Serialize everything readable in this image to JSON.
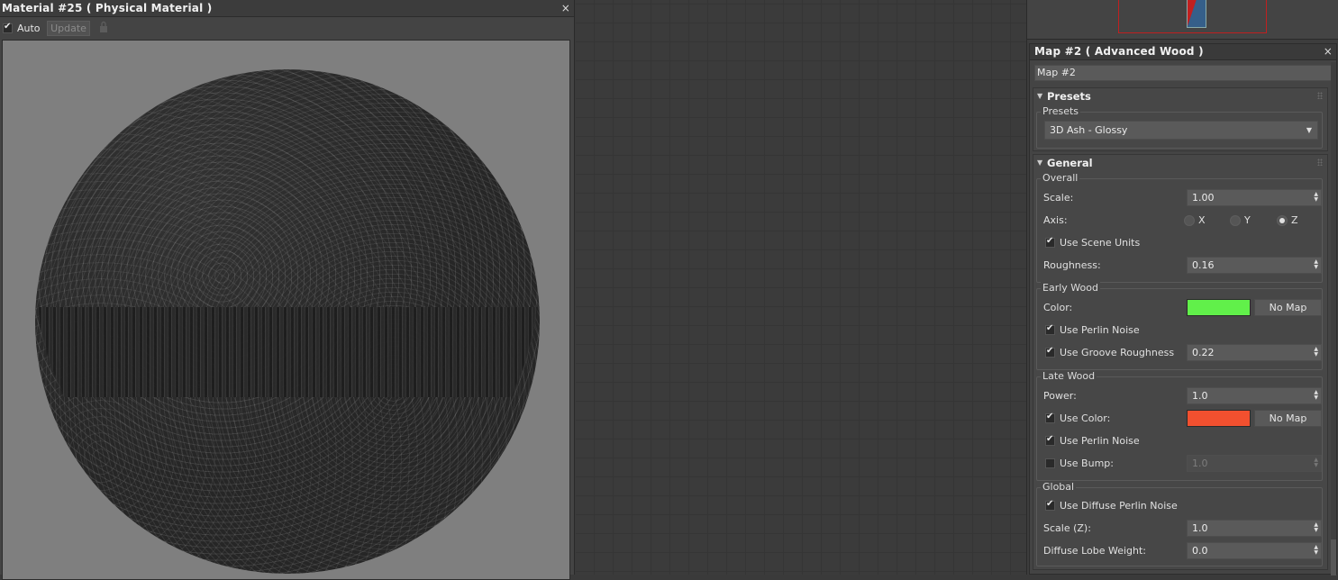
{
  "preview_window": {
    "title": "Material #25  ( Physical Material )",
    "close": "×",
    "auto_label": "Auto",
    "auto_checked": true,
    "update_label": "Update",
    "lock_icon": "lock-icon"
  },
  "nav_view": {
    "frame_color": "#c02020",
    "node_color": "#355f8a"
  },
  "params": {
    "title": "Map #2  ( Advanced Wood )",
    "close": "×",
    "map_name": "Map #2",
    "presets": {
      "heading": "Presets",
      "group_label": "Presets",
      "selected": "3D Ash - Glossy"
    },
    "general": {
      "heading": "General",
      "overall": {
        "label": "Overall",
        "scale_label": "Scale:",
        "scale_value": "1.00",
        "axis_label": "Axis:",
        "axis_options": [
          "X",
          "Y",
          "Z"
        ],
        "axis_selected": "Z",
        "use_scene_units_label": "Use Scene Units",
        "use_scene_units": true,
        "roughness_label": "Roughness:",
        "roughness_value": "0.16"
      },
      "early_wood": {
        "label": "Early Wood",
        "color_label": "Color:",
        "color": "#61f04a",
        "no_map_label": "No Map",
        "use_perlin_label": "Use Perlin Noise",
        "use_perlin": true,
        "groove_label": "Use Groove Roughness",
        "groove_checked": true,
        "groove_value": "0.22"
      },
      "late_wood": {
        "label": "Late Wood",
        "power_label": "Power:",
        "power_value": "1.0",
        "use_color_label": "Use Color:",
        "use_color": true,
        "color": "#f2502f",
        "no_map_label": "No Map",
        "use_perlin_label": "Use Perlin Noise",
        "use_perlin": true,
        "use_bump_label": "Use Bump:",
        "use_bump": false,
        "bump_value": "1.0"
      },
      "global": {
        "label": "Global",
        "diffuse_perlin_label": "Use Diffuse Perlin Noise",
        "diffuse_perlin": true,
        "scale_z_label": "Scale (Z):",
        "scale_z_value": "1.0",
        "lobe_label": "Diffuse Lobe Weight:",
        "lobe_value": "0.0"
      }
    }
  }
}
